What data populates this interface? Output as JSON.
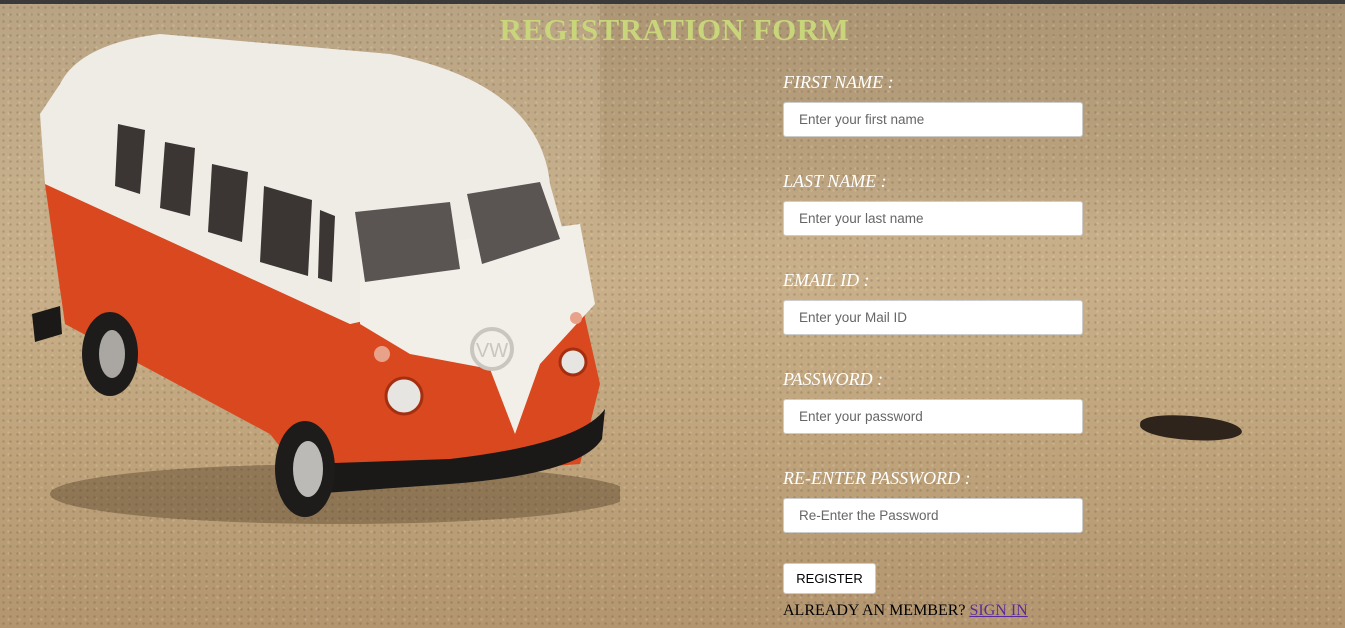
{
  "page": {
    "title": "REGISTRATION FORM"
  },
  "form": {
    "fields": [
      {
        "label": "FIRST NAME :",
        "placeholder": "Enter your first name"
      },
      {
        "label": "LAST NAME :",
        "placeholder": "Enter your last name"
      },
      {
        "label": "EMAIL ID :",
        "placeholder": "Enter your Mail ID"
      },
      {
        "label": "PASSWORD :",
        "placeholder": "Enter your password"
      },
      {
        "label": "RE-ENTER PASSWORD :",
        "placeholder": "Re-Enter the Password"
      }
    ],
    "register_label": "REGISTER",
    "footer_text": "ALREADY AN MEMBER? ",
    "sign_in_label": "SIGN IN"
  },
  "colors": {
    "title": "#c9d57a",
    "labels": "#ffffff",
    "link": "#5a2a9a"
  },
  "background": {
    "image": "toy-van-on-sand"
  }
}
